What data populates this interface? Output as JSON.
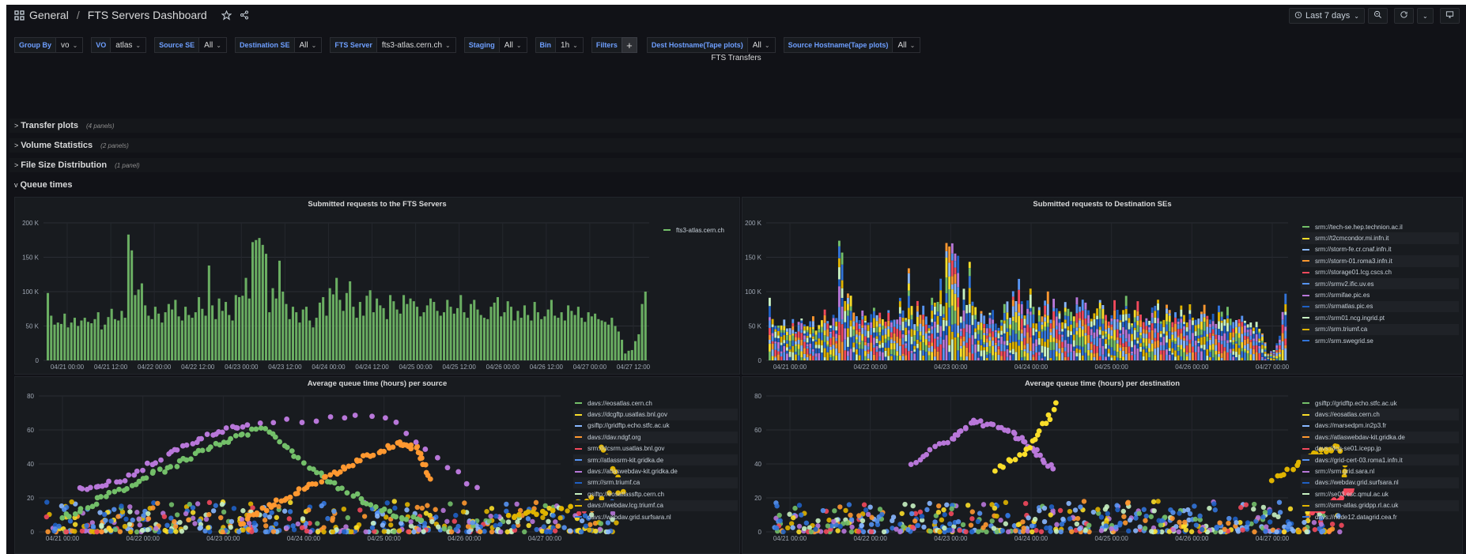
{
  "breadcrumb": {
    "folder": "General",
    "separator": "/",
    "title": "FTS Servers Dashboard"
  },
  "toolbar": {
    "time_range": "Last 7 days"
  },
  "variables": [
    {
      "label": "Group By",
      "value": "vo"
    },
    {
      "label": "VO",
      "value": "atlas"
    },
    {
      "label": "Source SE",
      "value": "All"
    },
    {
      "label": "Destination SE",
      "value": "All"
    },
    {
      "label": "FTS Server",
      "value": "fts3-atlas.cern.ch"
    },
    {
      "label": "Staging",
      "value": "All"
    },
    {
      "label": "Bin",
      "value": "1h"
    }
  ],
  "filters_label": "Filters",
  "variables2": [
    {
      "label": "Dest Hostname(Tape plots)",
      "value": "All"
    },
    {
      "label": "Source Hostname(Tape plots)",
      "value": "All"
    }
  ],
  "section_title": "FTS Transfers",
  "rows": [
    {
      "title": "Transfer plots",
      "count": "(4 panels)",
      "chevron": ">"
    },
    {
      "title": "Volume Statistics",
      "count": "(2 panels)",
      "chevron": ">"
    },
    {
      "title": "File Size Distribution",
      "count": "(1 panel)",
      "chevron": ">"
    },
    {
      "title": "Queue times",
      "count": "",
      "chevron": "v"
    }
  ],
  "colors": {
    "green": "#73bf69",
    "yellow": "#fade2a",
    "blue": "#5794f2",
    "orange": "#ff9830",
    "red": "#f2495c",
    "purple": "#b877d9",
    "darkblue": "#1f60c4",
    "lightgreen": "#c8f2c2",
    "cyan": "#8ab8ff"
  },
  "panels": {
    "fts_servers": {
      "title": "Submitted requests to the FTS Servers",
      "legend": [
        "fts3-atlas.cern.ch"
      ]
    },
    "dest_ses": {
      "title": "Submitted requests to Destination SEs",
      "legend": [
        "srm://tech-se.hep.technion.ac.il",
        "srm://t2cmcondor.mi.infn.it",
        "srm://storm-fe.cr.cnaf.infn.it",
        "srm://storm-01.roma3.infn.it",
        "srm://storage01.lcg.cscs.ch",
        "srm://srmv2.ific.uv.es",
        "srm://srmifae.pic.es",
        "srm://srmatlas.pic.es",
        "srm://srm01.ncg.ingrid.pt",
        "srm://srm.triumf.ca",
        "srm://srm.swegrid.se"
      ]
    },
    "queue_source": {
      "title": "Average queue time (hours) per source",
      "legend": [
        "davs://eosatlas.cern.ch",
        "davs://dcgftp.usatlas.bnl.gov",
        "gsiftp://gridftp.echo.stfc.ac.uk",
        "davs://dav.ndgf.org",
        "srm://dcsrm.usatlas.bnl.gov",
        "srm://atlassrm-kit.gridka.de",
        "davs://atlaswebdav-kit.gridka.de",
        "srm://srm.triumf.ca",
        "gsiftp://eosatlassftp.cern.ch",
        "davs://webdav.lcg.triumf.ca",
        "davs://webdav.grid.surfsara.nl"
      ]
    },
    "queue_dest": {
      "title": "Average queue time (hours) per destination",
      "legend": [
        "gsiftp://gridftp.echo.stfc.ac.uk",
        "davs://eosatlas.cern.ch",
        "davs://marsedpm.in2p3.fr",
        "davs://atlaswebdav-kit.gridka.de",
        "davs://lcg-se01.icepp.jp",
        "davs://grid-cert-03.roma1.infn.it",
        "srm://srm.grid.sara.nl",
        "davs://webdav.grid.surfsara.nl",
        "srm://se03.esc.qmul.ac.uk",
        "srm://srm-atlas.gridpp.rl.ac.uk",
        "davs://node12.datagrid.cea.fr"
      ]
    }
  },
  "chart_data": [
    {
      "type": "bar",
      "title": "Submitted requests to the FTS Servers",
      "ylim": [
        0,
        200000
      ],
      "yticks": [
        "0",
        "50 K",
        "100 K",
        "150 K",
        "200 K"
      ],
      "xticks": [
        "04/21 00:00",
        "04/21 12:00",
        "04/22 00:00",
        "04/22 12:00",
        "04/23 00:00",
        "04/23 12:00",
        "04/24 00:00",
        "04/24 12:00",
        "04/25 00:00",
        "04/25 12:00",
        "04/26 00:00",
        "04/26 12:00",
        "04/27 00:00",
        "04/27 12:00"
      ],
      "series": [
        {
          "name": "fts3-atlas.cern.ch",
          "values": [
            98000,
            65000,
            52000,
            55000,
            53000,
            68000,
            48000,
            55000,
            62000,
            50000,
            58000,
            62000,
            56000,
            54000,
            60000,
            70000,
            45000,
            52000,
            63000,
            75000,
            60000,
            58000,
            72000,
            62000,
            183000,
            160000,
            95000,
            103000,
            112000,
            80000,
            65000,
            60000,
            78000,
            68000,
            55000,
            70000,
            82000,
            74000,
            88000,
            64000,
            58000,
            78000,
            66000,
            62000,
            70000,
            92000,
            75000,
            65000,
            138000,
            80000,
            60000,
            90000,
            72000,
            85000,
            66000,
            58000,
            95000,
            92000,
            94000,
            120000,
            90000,
            172000,
            175000,
            178000,
            168000,
            155000,
            70000,
            105000,
            90000,
            145000,
            100000,
            82000,
            60000,
            78000,
            70000,
            55000,
            74000,
            78000,
            58000,
            48000,
            62000,
            84000,
            92000,
            65000,
            105000,
            96000,
            120000,
            88000,
            72000,
            98000,
            115000,
            78000,
            62000,
            85000,
            65000,
            94000,
            102000,
            70000,
            90000,
            80000,
            76000,
            60000,
            95000,
            86000,
            74000,
            68000,
            95000,
            82000,
            90000,
            86000,
            78000,
            64000,
            70000,
            80000,
            90000,
            85000,
            72000,
            65000,
            70000,
            88000,
            78000,
            68000,
            76000,
            95000,
            70000,
            62000,
            82000,
            88000,
            74000,
            66000,
            62000,
            60000,
            78000,
            84000,
            92000,
            64000,
            70000,
            86000,
            78000,
            58000,
            72000,
            62000,
            80000,
            66000,
            58000,
            85000,
            70000,
            60000,
            64000,
            74000,
            88000,
            65000,
            62000,
            70000,
            58000,
            80000,
            72000,
            66000,
            78000,
            62000,
            56000,
            70000,
            64000,
            68000,
            60000,
            58000,
            56000,
            52000,
            62000,
            50000,
            42000,
            30000,
            10000,
            14000,
            15000,
            28000,
            38000,
            82000,
            100000
          ]
        }
      ]
    },
    {
      "type": "bar",
      "stacked": true,
      "title": "Submitted requests to Destination SEs",
      "ylim": [
        0,
        200000
      ],
      "yticks": [
        "0",
        "50 K",
        "100 K",
        "150 K",
        "200 K"
      ],
      "xticks": [
        "04/21 00:00",
        "04/22 00:00",
        "04/23 00:00",
        "04/24 00:00",
        "04/25 00:00",
        "04/26 00:00",
        "04/27 00:00"
      ],
      "series_names": [
        "srm://tech-se.hep.technion.ac.il",
        "srm://t2cmcondor.mi.infn.it",
        "srm://storm-fe.cr.cnaf.infn.it",
        "srm://storm-01.roma3.infn.it",
        "srm://storage01.lcg.cscs.ch",
        "srm://srmv2.ific.uv.es",
        "srm://srmifae.pic.es",
        "srm://srmatlas.pic.es",
        "srm://srm01.ncg.ingrid.pt",
        "srm://srm.triumf.ca",
        "srm://srm.swegrid.se"
      ],
      "totals": [
        98000,
        65000,
        52000,
        55000,
        53000,
        68000,
        48000,
        55000,
        62000,
        50000,
        58000,
        62000,
        56000,
        54000,
        60000,
        70000,
        45000,
        52000,
        63000,
        75000,
        60000,
        58000,
        72000,
        62000,
        183000,
        160000,
        95000,
        103000,
        112000,
        80000,
        65000,
        60000,
        78000,
        68000,
        55000,
        70000,
        82000,
        74000,
        88000,
        64000,
        58000,
        78000,
        66000,
        62000,
        70000,
        92000,
        75000,
        65000,
        138000,
        80000,
        60000,
        90000,
        72000,
        85000,
        66000,
        58000,
        95000,
        92000,
        94000,
        120000,
        90000,
        172000,
        175000,
        178000,
        168000,
        155000,
        70000,
        105000,
        90000,
        145000,
        100000,
        82000,
        60000,
        78000,
        70000,
        55000,
        74000,
        78000,
        58000,
        48000,
        62000,
        84000,
        92000,
        65000,
        105000,
        96000,
        120000,
        88000,
        72000,
        98000,
        115000,
        78000,
        62000,
        85000,
        65000,
        94000,
        102000,
        70000,
        90000,
        80000,
        76000,
        60000,
        95000,
        86000,
        74000,
        68000,
        95000,
        82000,
        90000,
        86000,
        78000,
        64000,
        70000,
        80000,
        90000,
        85000,
        72000,
        65000,
        70000,
        88000,
        78000,
        68000,
        76000,
        95000,
        70000,
        62000,
        82000,
        88000,
        74000,
        66000,
        62000,
        60000,
        78000,
        84000,
        92000,
        64000,
        70000,
        86000,
        78000,
        58000,
        72000,
        62000,
        80000,
        66000,
        58000,
        85000,
        70000,
        60000,
        64000,
        74000,
        88000,
        65000,
        62000,
        70000,
        58000,
        80000,
        72000,
        66000,
        78000,
        62000,
        56000,
        70000,
        64000,
        68000,
        60000,
        58000,
        56000,
        52000,
        62000,
        50000,
        42000,
        30000,
        10000,
        14000,
        15000,
        28000,
        38000,
        82000,
        100000
      ]
    },
    {
      "type": "scatter",
      "title": "Average queue time (hours) per source",
      "ylim": [
        0,
        80
      ],
      "yticks": [
        "0",
        "20",
        "40",
        "60",
        "80"
      ],
      "xticks": [
        "04/21 00:00",
        "04/22 00:00",
        "04/23 00:00",
        "04/24 00:00",
        "04/25 00:00",
        "04/26 00:00",
        "04/27 00:00"
      ],
      "series": [
        {
          "name": "davs://eosatlas.cern.ch",
          "points": [
            [
              0.0,
              8
            ],
            [
              0.5,
              20
            ],
            [
              1.0,
              31
            ],
            [
              1.5,
              42
            ],
            [
              2.0,
              53
            ],
            [
              2.5,
              62
            ],
            [
              3.0,
              40
            ],
            [
              3.5,
              25
            ],
            [
              4.0,
              12
            ],
            [
              4.5,
              6
            ]
          ]
        },
        {
          "name": "davs://atlaswebdav-kit.gridka.de",
          "points": [
            [
              2.2,
              5
            ],
            [
              2.6,
              16
            ],
            [
              3.0,
              25
            ],
            [
              3.4,
              35
            ],
            [
              3.8,
              45
            ],
            [
              4.2,
              52
            ],
            [
              4.4,
              50
            ],
            [
              4.6,
              30
            ]
          ]
        },
        {
          "name": "gsiftp://gridftp.echo.stfc.ac.uk",
          "points": [
            [
              0.2,
              25
            ],
            [
              0.7,
              30
            ],
            [
              1.3,
              45
            ],
            [
              1.8,
              56
            ],
            [
              2.3,
              64
            ],
            [
              4.0,
              68
            ],
            [
              5.3,
              20
            ]
          ]
        },
        {
          "name": "srm://dcsrm.usatlas.bnl.gov",
          "points": [
            [
              6.7,
              50
            ],
            [
              7.0,
              25
            ],
            [
              6.0,
              12
            ],
            [
              5.5,
              8
            ]
          ]
        }
      ]
    },
    {
      "type": "scatter",
      "title": "Average queue time (hours) per destination",
      "ylim": [
        0,
        80
      ],
      "yticks": [
        "0",
        "20",
        "40",
        "60",
        "80"
      ],
      "xticks": [
        "04/21 00:00",
        "04/22 00:00",
        "04/23 00:00",
        "04/24 00:00",
        "04/25 00:00",
        "04/26 00:00",
        "04/27 00:00"
      ],
      "series": [
        {
          "name": "davs://webdav.grid.surfsara.nl",
          "points": [
            [
              1.5,
              40
            ],
            [
              2.0,
              55
            ],
            [
              2.3,
              65
            ],
            [
              2.7,
              60
            ],
            [
              3.0,
              50
            ],
            [
              3.3,
              35
            ]
          ]
        },
        {
          "name": "davs://eosatlas.cern.ch",
          "points": [
            [
              6.0,
              30
            ],
            [
              6.5,
              45
            ],
            [
              6.8,
              50
            ],
            [
              7.0,
              20
            ]
          ]
        },
        {
          "name": "davs://marsedpm.in2p3.fr",
          "points": [
            [
              3.3,
              75
            ],
            [
              3.0,
              50
            ],
            [
              2.5,
              35
            ]
          ]
        },
        {
          "name": "srm://se03.esc.qmul.ac.uk",
          "points": [
            [
              6.5,
              10
            ],
            [
              6.9,
              22
            ],
            [
              7.0,
              25
            ]
          ]
        }
      ]
    }
  ]
}
